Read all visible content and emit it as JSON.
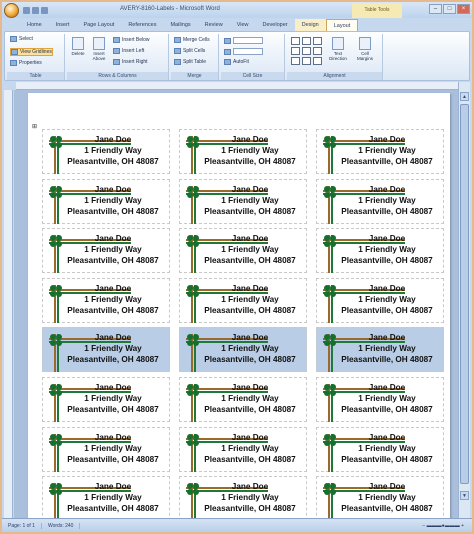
{
  "window": {
    "title": "AVERY-8160-Labels - Microsoft Word"
  },
  "contextual_group": "Table Tools",
  "tabs": [
    {
      "label": "Home"
    },
    {
      "label": "Insert"
    },
    {
      "label": "Page Layout"
    },
    {
      "label": "References"
    },
    {
      "label": "Mailings"
    },
    {
      "label": "Review"
    },
    {
      "label": "View"
    },
    {
      "label": "Developer"
    },
    {
      "label": "Design"
    },
    {
      "label": "Layout"
    }
  ],
  "ribbon": {
    "table_group": {
      "label": "Table",
      "items": [
        "Select",
        "View Gridlines",
        "Properties"
      ]
    },
    "rows_cols_group": {
      "label": "Rows & Columns",
      "delete": "Delete",
      "insert_above": "Insert Above",
      "insert_below": "Insert Below",
      "insert_left": "Insert Left",
      "insert_right": "Insert Right"
    },
    "merge_group": {
      "label": "Merge",
      "items": [
        "Merge Cells",
        "Split Cells",
        "Split Table"
      ]
    },
    "cell_size_group": {
      "label": "Cell Size",
      "autofit": "AutoFit"
    },
    "alignment_group": {
      "label": "Alignment",
      "text_direction": "Text Direction",
      "cell_margins": "Cell Margins"
    }
  },
  "labels": {
    "name": "Jane Doe",
    "street": "1 Friendly Way",
    "city": "Pleasantville, OH 48087",
    "rows": 8,
    "cols": 3,
    "selected_row": 5
  },
  "status": {
    "page": "Page: 1 of 1",
    "words": "Words: 240"
  },
  "colors": {
    "ribbon_accent": "#c5d8ee",
    "selection": "#b9cde6",
    "clover": "#176f2e",
    "ribbon_brown": "#9a6a2a"
  }
}
